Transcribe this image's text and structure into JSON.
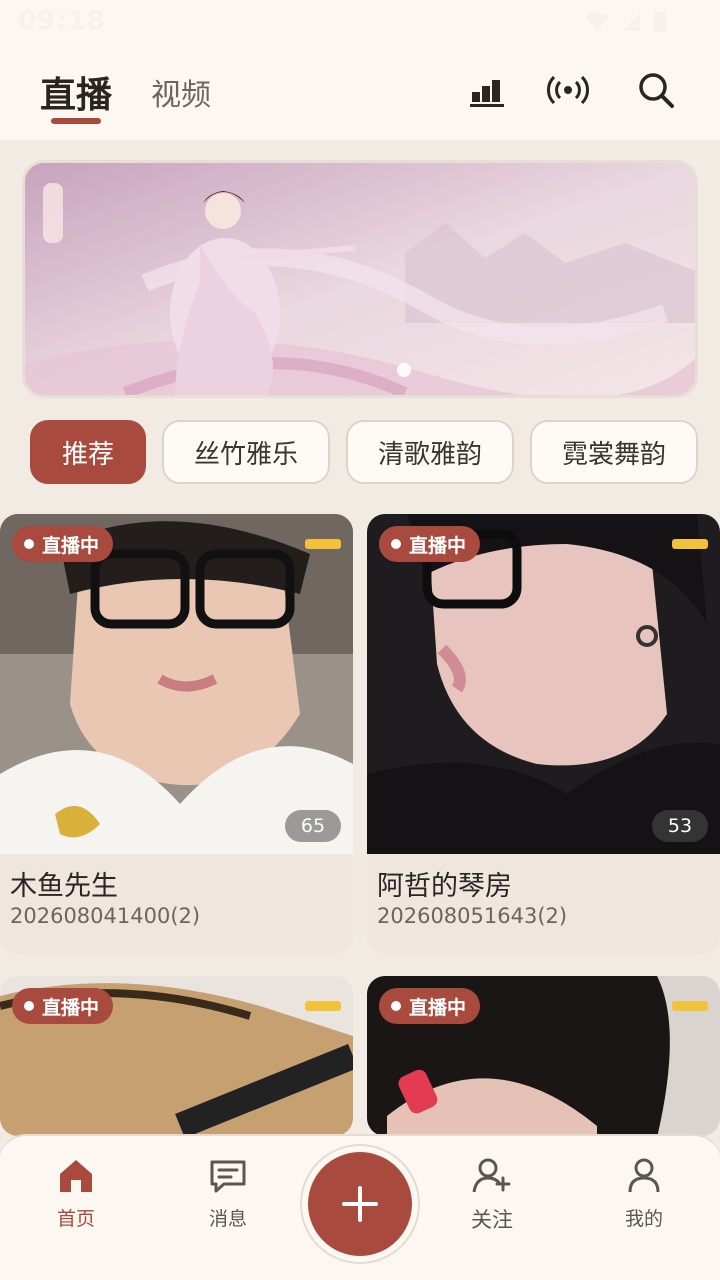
{
  "status_bar": {
    "time": "09:18"
  },
  "header": {
    "tabs": [
      {
        "label": "直播",
        "active": true
      },
      {
        "label": "视频",
        "active": false
      }
    ],
    "icons": [
      "ranking-icon",
      "broadcast-icon",
      "search-icon"
    ]
  },
  "banner": {
    "slides": 1,
    "active_slide": 1
  },
  "categories": [
    {
      "label": "推荐",
      "active": true
    },
    {
      "label": "丝竹雅乐",
      "active": false
    },
    {
      "label": "清歌雅韵",
      "active": false
    },
    {
      "label": "霓裳舞韵",
      "active": false
    }
  ],
  "streams": [
    {
      "badge": "直播中",
      "viewers": "65",
      "title": "木鱼先生",
      "subtitle": "202608041400(2)"
    },
    {
      "badge": "直播中",
      "viewers": "53",
      "title": "阿哲的琴房",
      "subtitle": "202608051643(2)"
    },
    {
      "badge": "直播中",
      "viewers": "",
      "title": "",
      "subtitle": ""
    },
    {
      "badge": "直播中",
      "viewers": "",
      "title": "",
      "subtitle": ""
    }
  ],
  "bottom_nav": {
    "items": [
      {
        "label": "首页",
        "icon": "home-icon",
        "active": true
      },
      {
        "label": "消息",
        "icon": "message-icon",
        "active": false
      },
      {
        "label": "关注",
        "icon": "follow-icon",
        "active": false
      },
      {
        "label": "我的",
        "icon": "profile-icon",
        "active": false
      }
    ],
    "fab_icon": "plus-icon"
  },
  "colors": {
    "accent": "#a84a3d",
    "background": "#f1ebe4",
    "surface": "#fcf8f1"
  }
}
